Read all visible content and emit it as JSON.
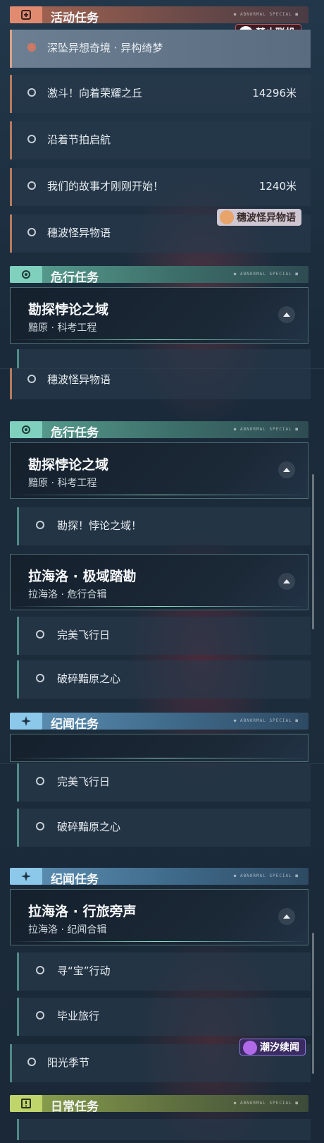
{
  "sections": {
    "activity": "活动任务",
    "danger": "危行任务",
    "legend": "纪闻任务",
    "daily": "日常任务",
    "header_deco": "● ABNORMAL SPECIAL ■"
  },
  "panel1": {
    "tasks": [
      {
        "label": "深坠异想奇境 · 异构绮梦",
        "dist": ""
      },
      {
        "label": "激斗！向着荣耀之丘",
        "dist": "14296米"
      },
      {
        "label": "沿着节拍启航",
        "dist": ""
      },
      {
        "label": "我们的故事才刚刚开始！",
        "dist": "1240米"
      },
      {
        "label": "穗波怪异物语",
        "dist": ""
      }
    ],
    "group": {
      "title": "勘探悖论之域",
      "sub": "黯原 · 科考工程"
    }
  },
  "panel2": {
    "top_task": "穗波怪异物语",
    "group1": {
      "title": "勘探悖论之域",
      "sub": "黯原 · 科考工程"
    },
    "sub1": [
      "勘探！悖论之域！"
    ],
    "group2": {
      "title": "拉海洛 · 极域踏勘",
      "sub": "拉海洛 · 危行合辑"
    },
    "sub2": [
      "完美飞行日",
      "破碎黯原之心"
    ]
  },
  "panel3": {
    "sub_top": [
      "完美飞行日",
      "破碎黯原之心"
    ],
    "group": {
      "title": "拉海洛 · 行旅旁声",
      "sub": "拉海洛 · 纪闻合辑"
    },
    "subs": [
      "寻“宝”行动",
      "毕业旅行",
      "阳光季节"
    ]
  },
  "badges": {
    "no_multiplayer": "禁止联机",
    "event_tag": "穗波怪异物语",
    "tide_tag": "潮汐续闻"
  },
  "colors": {
    "activity": "#e08a70",
    "danger": "#7fd0bd",
    "legend": "#8cc8ea",
    "daily": "#bfd56b"
  }
}
